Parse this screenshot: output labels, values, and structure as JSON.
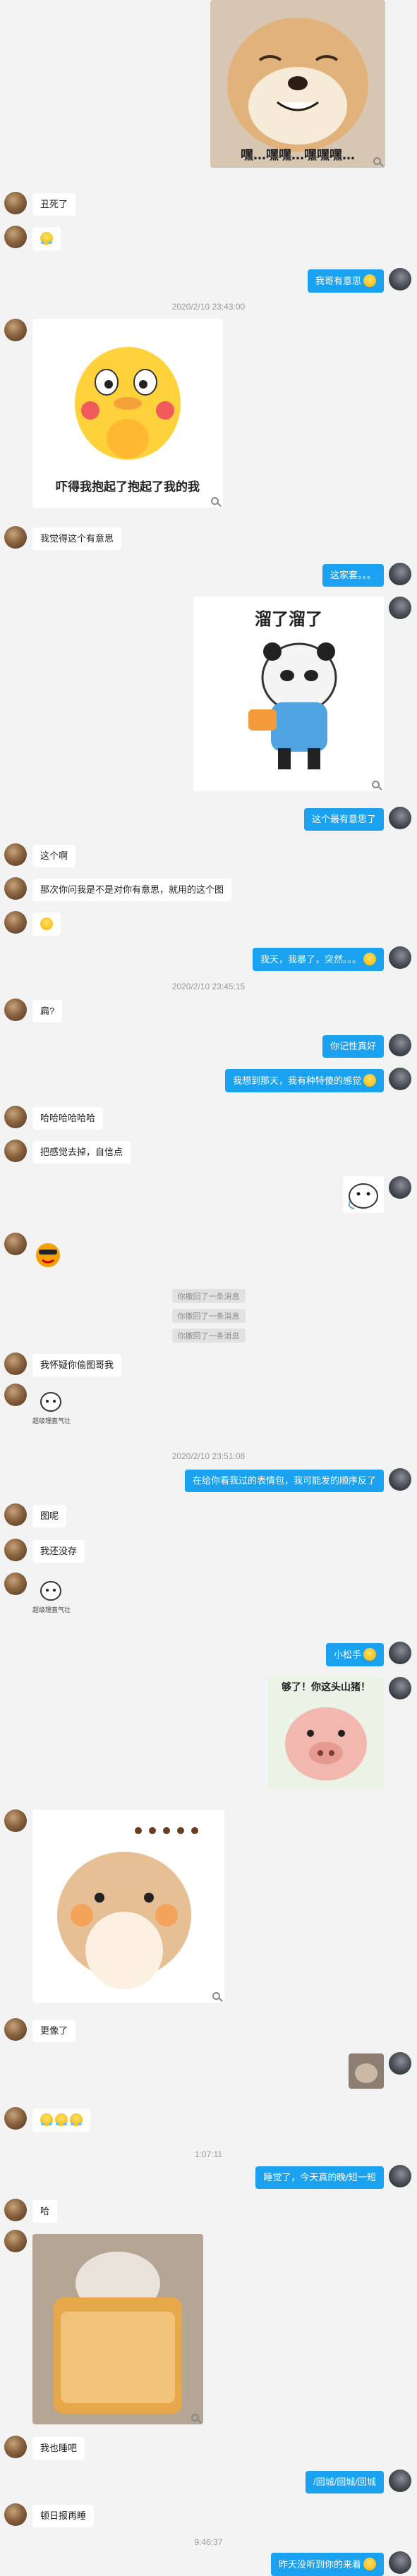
{
  "messages": {
    "m1_caption": "嘿…嘿嘿…嘿嘿嘿…",
    "m2": "丑死了",
    "m4": "我哥有意思",
    "ts1": "2020/2/10 23:43:00",
    "m5_caption": "吓得我抱起了抱起了我的我",
    "m6": "我觉得这个有意思",
    "m7": "这家套。。。",
    "m8_caption": "溜了溜了",
    "m9": "这个最有意思了",
    "m10": "这个啊",
    "m11": "那次你问我是不是对你有意思，就用的这个图",
    "m13": "我天，我暴了，突然。。。",
    "ts2": "2020/2/10 23:45:15",
    "m14": "扁?",
    "m15": "你记性真好",
    "m16": "我想到那天，我有种特傻的感觉",
    "m17": "哈哈哈哈哈哈",
    "m18": "把感觉去掉，自信点",
    "recall1": "你撤回了一条消息",
    "recall2": "你撤回了一条消息",
    "recall3": "你撤回了一条消息",
    "m19": "我怀疑你偷图哥我",
    "m20_caption": "超级理直气壮",
    "ts3": "2020/2/10 23:51:08",
    "m21": "在给你看我过的表情包，我可能发的顺序反了",
    "m22": "图呢",
    "m23": "我还没存",
    "m24_caption": "超级理直气壮",
    "m25": "小松手",
    "m26_caption": "够了！你这头山猪！",
    "m28": "更像了",
    "ts4": "1:07:11",
    "m31": "睡觉了，今天真的晚/短一短",
    "m32": "哈",
    "m34": "我也睡吧",
    "m35": "/回城/回城/回城",
    "m36": "顿日报再睡",
    "ts5": "9:46:37",
    "m37": "昨天没听到你的来着"
  },
  "colors": {
    "self_bubble": "#1aa1f0",
    "other_bubble": "#ffffff",
    "background": "#f3f3f3",
    "timestamp": "#9a9a9a"
  },
  "icons": {
    "zoom": "magnify-icon",
    "emoji": "smiley-icon"
  }
}
